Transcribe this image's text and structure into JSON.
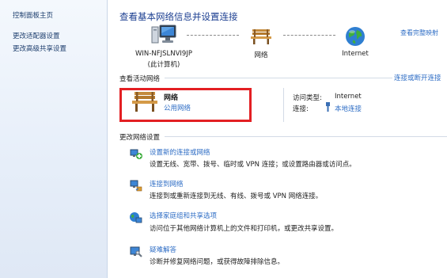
{
  "left_nav": {
    "home": "控制面板主页",
    "change_adapter": "更改适配器设置",
    "change_sharing": "更改高级共享设置"
  },
  "main": {
    "title": "查看基本网络信息并设置连接",
    "full_map": "查看完整映射"
  },
  "network_map": {
    "computer_name": "WIN-NFJSLNVI9JP",
    "computer_sub": "(此计算机)",
    "network": "网络",
    "internet": "Internet"
  },
  "active_networks": {
    "header": "查看活动网络",
    "connect_disconnect": "连接或断开连接",
    "network_name": "网络",
    "network_type": "公用网络",
    "access_type_label": "访问类型:",
    "access_type_value": "Internet",
    "connections_label": "连接:",
    "connections_value": "本地连接"
  },
  "change_settings": {
    "header": "更改网络设置",
    "tasks": [
      {
        "link": "设置新的连接或网络",
        "desc": "设置无线、宽带、拨号、临时或 VPN 连接；或设置路由器或访问点。",
        "icon": "new-connection-icon"
      },
      {
        "link": "连接到网络",
        "desc": "连接到或重新连接到无线、有线、拨号或 VPN 网络连接。",
        "icon": "connect-network-icon"
      },
      {
        "link": "选择家庭组和共享选项",
        "desc": "访问位于其他网络计算机上的文件和打印机，或更改共享设置。",
        "icon": "homegroup-icon"
      },
      {
        "link": "疑难解答",
        "desc": "诊断并修复网络问题，或获得故障排除信息。",
        "icon": "troubleshoot-icon"
      }
    ]
  },
  "colors": {
    "link": "#2e6dc5",
    "title": "#1c3f91",
    "highlight": "#e31f23"
  }
}
